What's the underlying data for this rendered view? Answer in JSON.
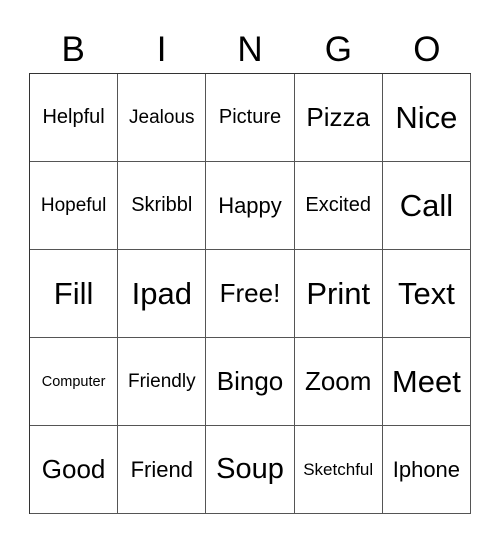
{
  "header": [
    "B",
    "I",
    "N",
    "G",
    "O"
  ],
  "card": {
    "rows": [
      [
        "Helpful",
        "Jealous",
        "Picture",
        "Pizza",
        "Nice"
      ],
      [
        "Hopeful",
        "Skribbl",
        "Happy",
        "Excited",
        "Call"
      ],
      [
        "Fill",
        "Ipad",
        "Free!",
        "Print",
        "Text"
      ],
      [
        "Computer",
        "Friendly",
        "Bingo",
        "Zoom",
        "Meet"
      ],
      [
        "Good",
        "Friend",
        "Soup",
        "Sketchful",
        "Iphone"
      ]
    ]
  }
}
